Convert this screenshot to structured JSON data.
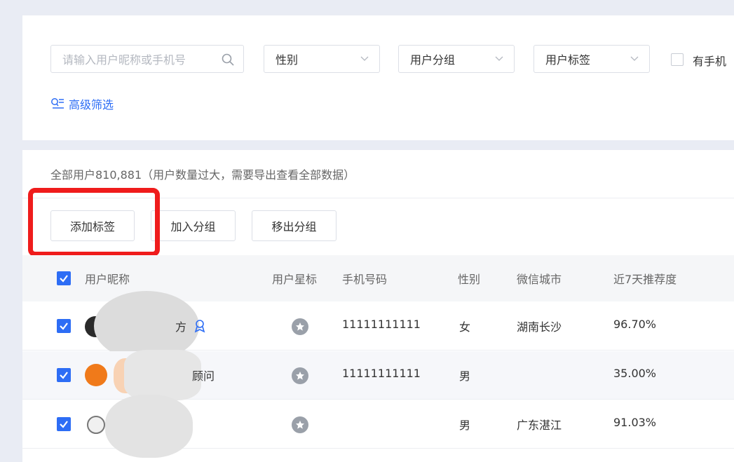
{
  "filters": {
    "search_placeholder": "请输入用户昵称或手机号",
    "gender_label": "性别",
    "group_label": "用户分组",
    "tag_label": "用户标签",
    "has_phone_label": "有手机",
    "advanced_filter_label": "高级筛选"
  },
  "list": {
    "summary": "全部用户810,881（用户数量过大，需要导出查看全部数据）",
    "actions": {
      "add_tag": "添加标签",
      "join_group": "加入分组",
      "remove_group": "移出分组"
    },
    "columns": {
      "nickname": "用户昵称",
      "star": "用户星标",
      "phone": "手机号码",
      "gender": "性别",
      "wechat_city": "微信城市",
      "recommend_7d": "近7天推荐度"
    },
    "rows": [
      {
        "name_fragment": "方",
        "phone": "11111111111",
        "gender": "女",
        "city": "湖南长沙",
        "recommend": "96.70%",
        "checked": true
      },
      {
        "name_fragment": "顾问",
        "phone": "11111111111",
        "gender": "男",
        "city": "",
        "recommend": "35.00%",
        "checked": true
      },
      {
        "name_fragment": "",
        "phone": "",
        "gender": "男",
        "city": "广东湛江",
        "recommend": "91.03%",
        "checked": true
      }
    ]
  },
  "colors": {
    "accent": "#2d6df5",
    "highlight": "#ef1c1c",
    "background": "#e9ecf4"
  }
}
